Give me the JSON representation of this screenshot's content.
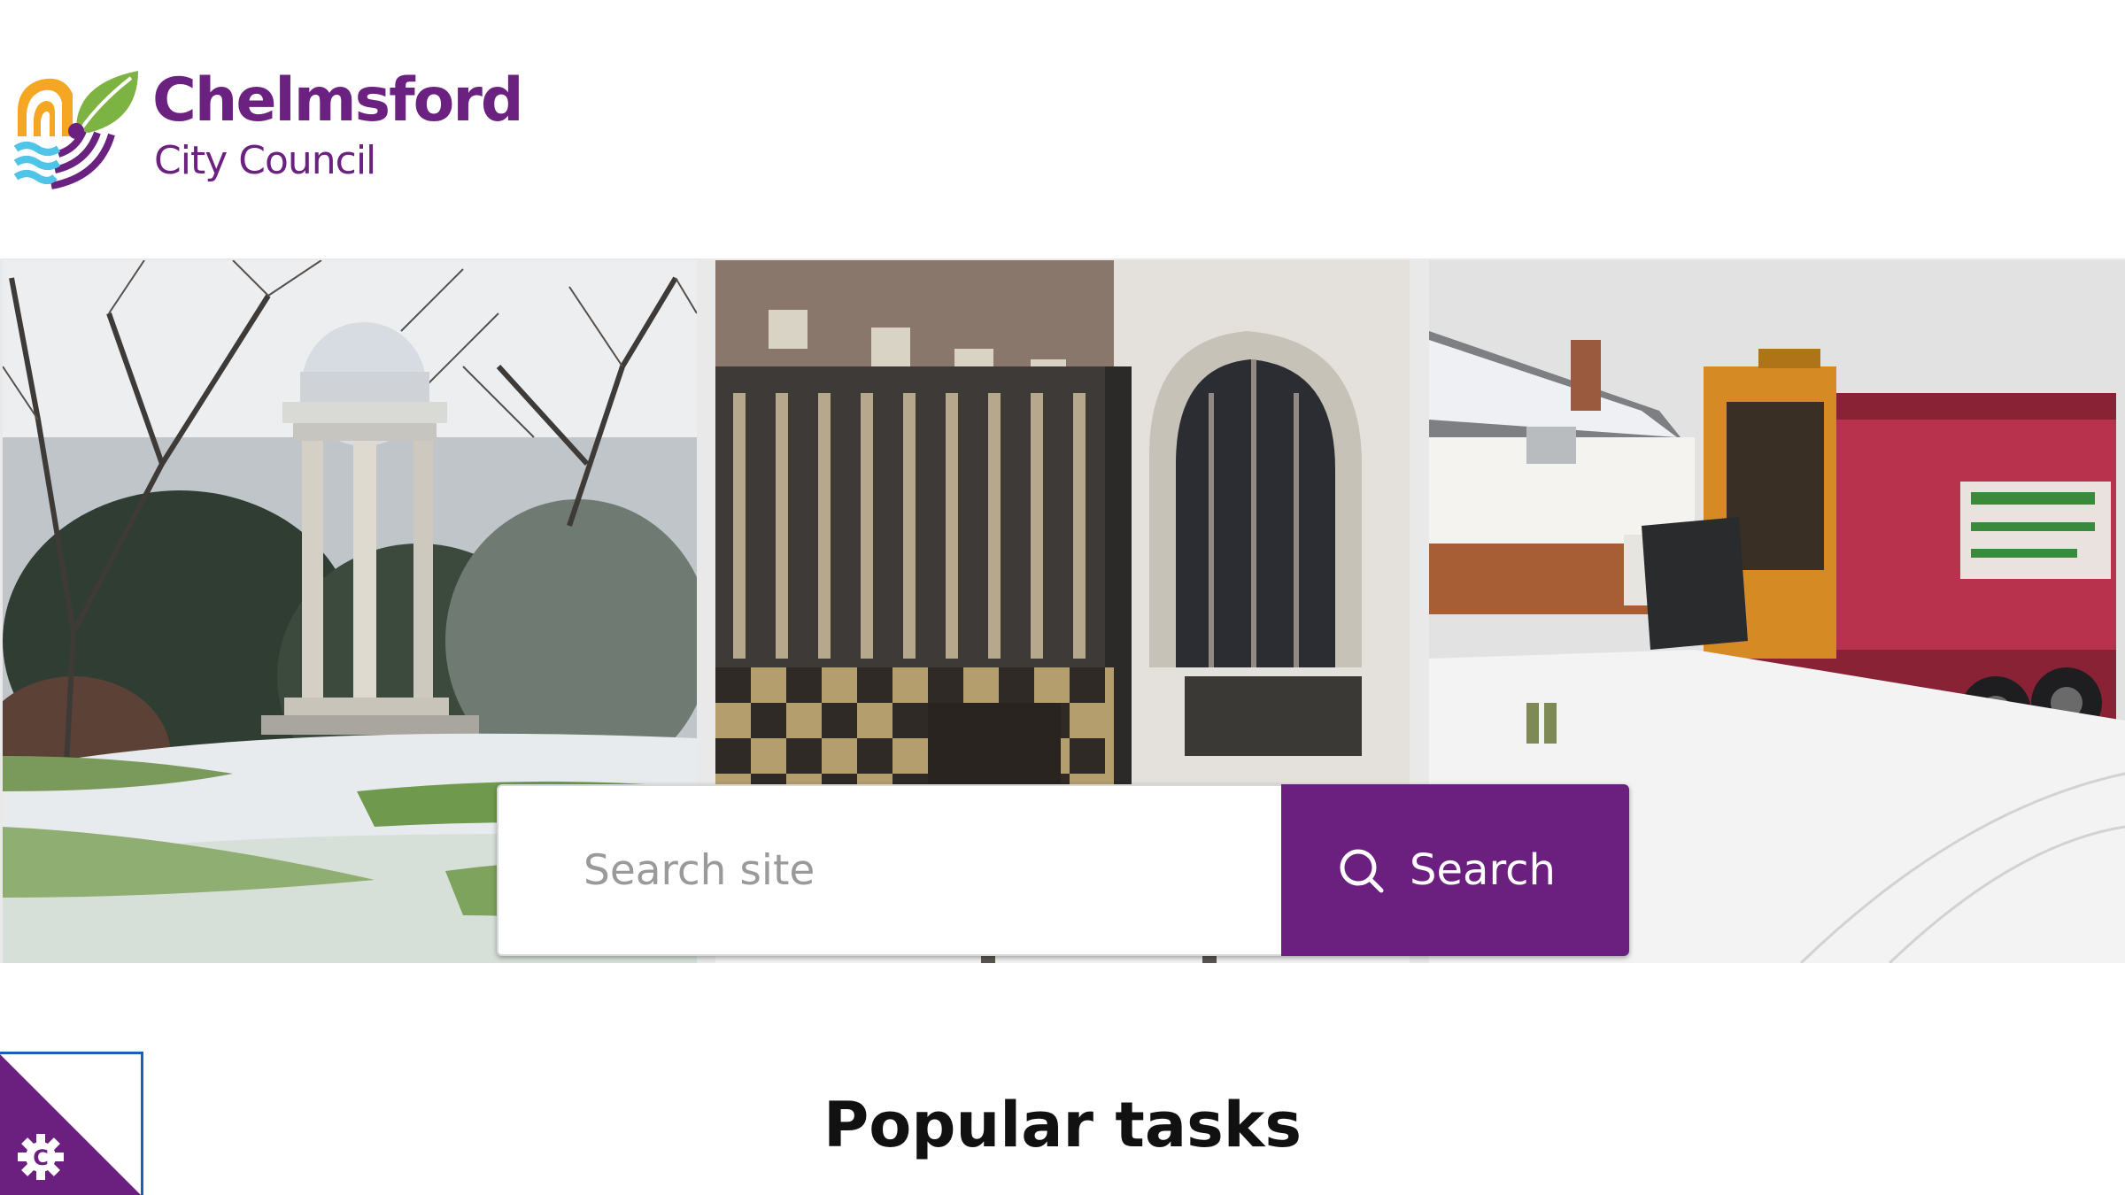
{
  "header": {
    "logo": {
      "name": "Chelmsford",
      "subtitle": "City Council"
    }
  },
  "hero": {
    "panels": [
      {
        "subject": "snowy park with stone rotunda"
      },
      {
        "subject": "flint chequered church wall with bench in snow"
      },
      {
        "subject": "refuse collection lorry on snowy street"
      }
    ]
  },
  "search": {
    "placeholder": "Search site",
    "button_label": "Search",
    "icon": "search-icon"
  },
  "popular_tasks": {
    "title": "Popular tasks"
  },
  "settings_widget": {
    "icon": "gear-icon",
    "letter": "C"
  },
  "colors": {
    "brand_purple": "#6b1f7f",
    "logo_green": "#7cb342",
    "logo_orange": "#f5a623",
    "logo_blue": "#4fc3e8",
    "widget_border": "#1c5fb8"
  }
}
